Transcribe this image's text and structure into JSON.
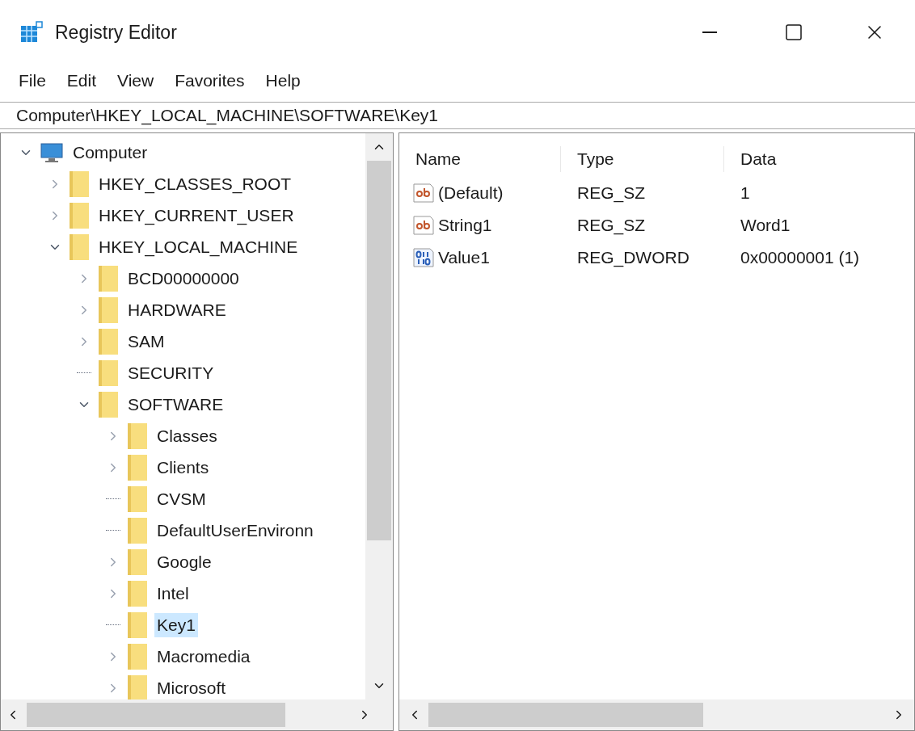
{
  "window": {
    "title": "Registry Editor"
  },
  "menu": [
    "File",
    "Edit",
    "View",
    "Favorites",
    "Help"
  ],
  "address": "Computer\\HKEY_LOCAL_MACHINE\\SOFTWARE\\Key1",
  "tree": [
    {
      "label": "Computer",
      "kind": "computer",
      "expanded": true,
      "selected": false,
      "children": [
        {
          "label": "HKEY_CLASSES_ROOT",
          "kind": "branch",
          "expanded": false,
          "selected": false
        },
        {
          "label": "HKEY_CURRENT_USER",
          "kind": "branch",
          "expanded": false,
          "selected": false
        },
        {
          "label": "HKEY_LOCAL_MACHINE",
          "kind": "branch",
          "expanded": true,
          "selected": false,
          "children": [
            {
              "label": "BCD00000000",
              "kind": "branch",
              "expanded": false,
              "selected": false
            },
            {
              "label": "HARDWARE",
              "kind": "branch",
              "expanded": false,
              "selected": false
            },
            {
              "label": "SAM",
              "kind": "branch",
              "expanded": false,
              "selected": false
            },
            {
              "label": "SECURITY",
              "kind": "leaf",
              "selected": false
            },
            {
              "label": "SOFTWARE",
              "kind": "branch",
              "expanded": true,
              "selected": false,
              "children": [
                {
                  "label": "Classes",
                  "kind": "branch",
                  "expanded": false,
                  "selected": false
                },
                {
                  "label": "Clients",
                  "kind": "branch",
                  "expanded": false,
                  "selected": false
                },
                {
                  "label": "CVSM",
                  "kind": "leaf",
                  "selected": false
                },
                {
                  "label": "DefaultUserEnvironn",
                  "kind": "leaf",
                  "selected": false
                },
                {
                  "label": "Google",
                  "kind": "branch",
                  "expanded": false,
                  "selected": false
                },
                {
                  "label": "Intel",
                  "kind": "branch",
                  "expanded": false,
                  "selected": false
                },
                {
                  "label": "Key1",
                  "kind": "leaf",
                  "selected": true
                },
                {
                  "label": "Macromedia",
                  "kind": "branch",
                  "expanded": false,
                  "selected": false
                },
                {
                  "label": "Microsoft",
                  "kind": "branch",
                  "expanded": false,
                  "selected": false
                }
              ]
            }
          ]
        }
      ]
    }
  ],
  "values": {
    "columns": [
      "Name",
      "Type",
      "Data"
    ],
    "rows": [
      {
        "kind": "string",
        "name": "(Default)",
        "type": "REG_SZ",
        "data": "1"
      },
      {
        "kind": "string",
        "name": "String1",
        "type": "REG_SZ",
        "data": "Word1"
      },
      {
        "kind": "binary",
        "name": "Value1",
        "type": "REG_DWORD",
        "data": "0x00000001 (1)"
      }
    ]
  }
}
